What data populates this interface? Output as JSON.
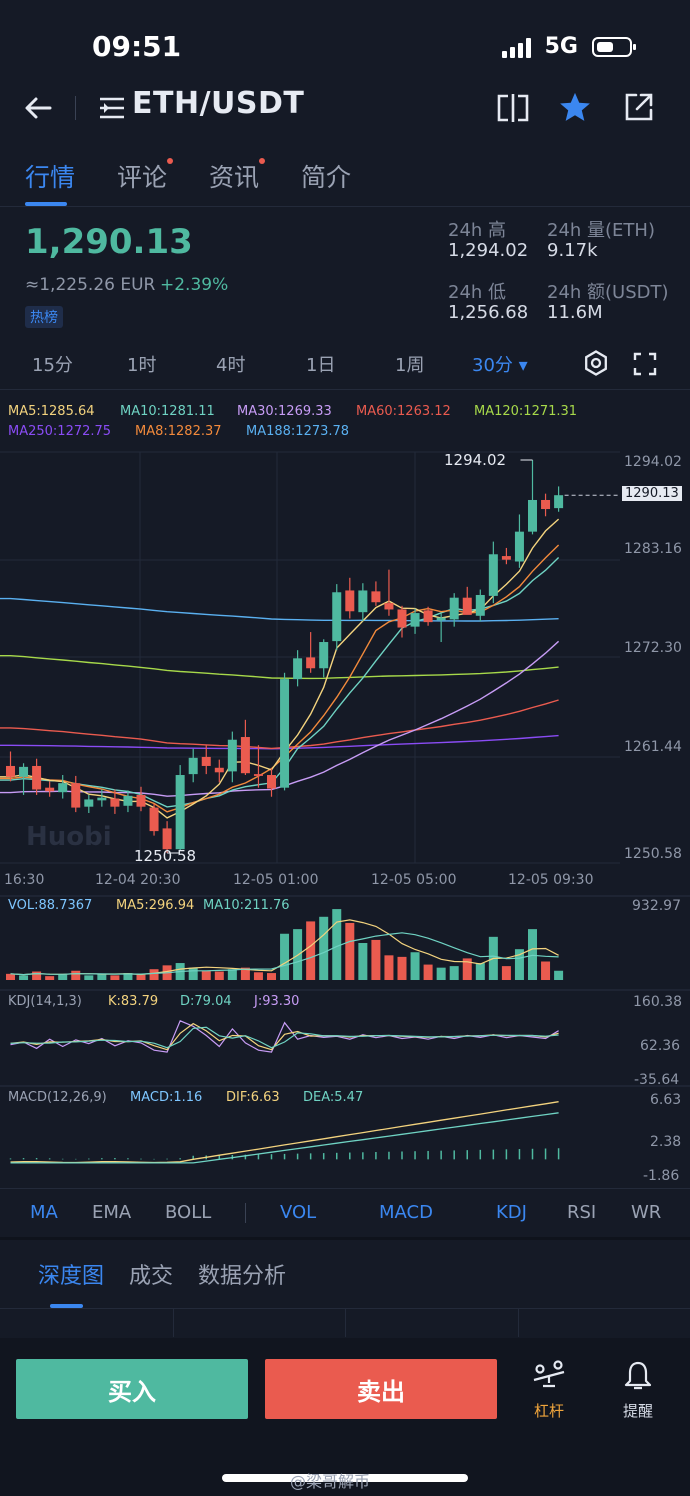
{
  "status_bar": {
    "time": "09:51",
    "network": "5G"
  },
  "header": {
    "pair": "ETH/USDT"
  },
  "tabs": [
    {
      "label": "行情",
      "active": true,
      "dot": false
    },
    {
      "label": "评论",
      "active": false,
      "dot": true
    },
    {
      "label": "资讯",
      "active": false,
      "dot": true
    },
    {
      "label": "简介",
      "active": false,
      "dot": false
    }
  ],
  "ticker": {
    "last_price": "1,290.13",
    "fiat_price": "≈1,225.26 EUR",
    "change": "+2.39%",
    "badge": "热榜",
    "high_label": "24h 高",
    "high": "1,294.02",
    "vol_label": "24h 量(ETH)",
    "vol": "9.17k",
    "low_label": "24h 低",
    "low": "1,256.68",
    "turnover_label": "24h 额(USDT)",
    "turnover": "11.6M"
  },
  "intervals": [
    "15分",
    "1时",
    "4时",
    "1日",
    "1周",
    "30分 ▾"
  ],
  "ma_legend": [
    {
      "text": "MA5:1285.64",
      "color": "#f3d37e"
    },
    {
      "text": "MA10:1281.11",
      "color": "#6fd3c3"
    },
    {
      "text": "MA30:1269.33",
      "color": "#c79cf5"
    },
    {
      "text": "MA60:1263.12",
      "color": "#ea5b4f"
    },
    {
      "text": "MA120:1271.31",
      "color": "#a7d94a"
    },
    {
      "text": "MA250:1272.75",
      "color": "#8a4cf5"
    },
    {
      "text": "MA8:1282.37",
      "color": "#f28a3c"
    },
    {
      "text": "MA188:1273.78",
      "color": "#5ab0f0"
    }
  ],
  "price_axis": [
    "1294.02",
    "1283.16",
    "1272.30",
    "1261.44",
    "1250.58"
  ],
  "current_price_tag": "1290.13",
  "high_marker": "1294.02",
  "low_marker": "1250.58",
  "time_axis": [
    "16:30",
    "12-04 20:30",
    "12-05 01:00",
    "12-05 05:00",
    "12-05 09:30"
  ],
  "volume": {
    "vol": "VOL:88.7367",
    "ma5": "MA5:296.94",
    "ma10": "MA10:211.76",
    "axis_top": "932.97"
  },
  "kdj": {
    "title": "KDJ(14,1,3)",
    "k": "K:83.79",
    "d": "D:79.04",
    "j": "J:93.30",
    "axis": [
      "160.38",
      "62.36",
      "-35.64"
    ]
  },
  "macd": {
    "title": "MACD(12,26,9)",
    "macd": "MACD:1.16",
    "dif": "DIF:6.63",
    "dea": "DEA:5.47",
    "axis": [
      "6.63",
      "2.38",
      "-1.86"
    ]
  },
  "indicator_tabs": [
    {
      "label": "MA",
      "on": true
    },
    {
      "label": "EMA",
      "on": false
    },
    {
      "label": "BOLL",
      "on": false
    },
    {
      "label": "VOL",
      "on": true
    },
    {
      "label": "MACD",
      "on": true
    },
    {
      "label": "KDJ",
      "on": true
    },
    {
      "label": "RSI",
      "on": false
    },
    {
      "label": "WR",
      "on": false
    }
  ],
  "bottom_tabs": [
    "深度图",
    "成交",
    "数据分析"
  ],
  "actions": {
    "buy": "买入",
    "sell": "卖出",
    "leverage": "杠杆",
    "alert": "提醒"
  },
  "watermark": "@梁哥解币",
  "colors": {
    "up": "#4fb9a0",
    "down": "#ea5b4f",
    "accent": "#3b87f0",
    "bg": "#151a26"
  },
  "chart_data": {
    "type": "candlestick",
    "candles": [
      {
        "o": 1260.2,
        "h": 1261.8,
        "l": 1258.5,
        "c": 1259.0
      },
      {
        "o": 1259.0,
        "h": 1260.5,
        "l": 1257.0,
        "c": 1260.1
      },
      {
        "o": 1260.2,
        "h": 1261.0,
        "l": 1257.0,
        "c": 1257.6
      },
      {
        "o": 1257.8,
        "h": 1258.5,
        "l": 1256.8,
        "c": 1257.4
      },
      {
        "o": 1257.3,
        "h": 1259.2,
        "l": 1256.6,
        "c": 1258.3
      },
      {
        "o": 1258.3,
        "h": 1259.1,
        "l": 1255.1,
        "c": 1255.6
      },
      {
        "o": 1255.7,
        "h": 1257.0,
        "l": 1255.0,
        "c": 1256.5
      },
      {
        "o": 1256.4,
        "h": 1257.6,
        "l": 1255.7,
        "c": 1256.7
      },
      {
        "o": 1256.6,
        "h": 1257.6,
        "l": 1254.9,
        "c": 1255.7
      },
      {
        "o": 1255.8,
        "h": 1257.5,
        "l": 1255.1,
        "c": 1256.9
      },
      {
        "o": 1257.0,
        "h": 1257.9,
        "l": 1255.2,
        "c": 1255.7
      },
      {
        "o": 1255.6,
        "h": 1256.0,
        "l": 1252.5,
        "c": 1253.0
      },
      {
        "o": 1253.3,
        "h": 1254.1,
        "l": 1250.58,
        "c": 1251.0
      },
      {
        "o": 1251.0,
        "h": 1260.3,
        "l": 1250.9,
        "c": 1259.2
      },
      {
        "o": 1259.3,
        "h": 1262.1,
        "l": 1258.4,
        "c": 1261.1
      },
      {
        "o": 1261.2,
        "h": 1262.5,
        "l": 1259.3,
        "c": 1260.2
      },
      {
        "o": 1260.0,
        "h": 1260.9,
        "l": 1258.4,
        "c": 1259.5
      },
      {
        "o": 1259.6,
        "h": 1264.0,
        "l": 1258.4,
        "c": 1263.1
      },
      {
        "o": 1263.4,
        "h": 1265.3,
        "l": 1259.2,
        "c": 1259.4
      },
      {
        "o": 1259.3,
        "h": 1262.5,
        "l": 1257.8,
        "c": 1259.1
      },
      {
        "o": 1259.2,
        "h": 1259.9,
        "l": 1256.8,
        "c": 1257.7
      },
      {
        "o": 1257.8,
        "h": 1270.5,
        "l": 1257.5,
        "c": 1269.8
      },
      {
        "o": 1269.8,
        "h": 1273.0,
        "l": 1269.0,
        "c": 1272.1
      },
      {
        "o": 1272.2,
        "h": 1275.0,
        "l": 1270.5,
        "c": 1271.0
      },
      {
        "o": 1271.0,
        "h": 1274.2,
        "l": 1270.0,
        "c": 1273.9
      },
      {
        "o": 1274.0,
        "h": 1280.3,
        "l": 1273.0,
        "c": 1279.4
      },
      {
        "o": 1279.6,
        "h": 1281.0,
        "l": 1276.5,
        "c": 1277.3
      },
      {
        "o": 1277.2,
        "h": 1280.4,
        "l": 1276.2,
        "c": 1279.6
      },
      {
        "o": 1279.5,
        "h": 1280.6,
        "l": 1277.9,
        "c": 1278.3
      },
      {
        "o": 1278.2,
        "h": 1281.9,
        "l": 1276.8,
        "c": 1277.5
      },
      {
        "o": 1277.5,
        "h": 1277.9,
        "l": 1274.4,
        "c": 1275.5
      },
      {
        "o": 1275.6,
        "h": 1277.6,
        "l": 1274.8,
        "c": 1277.1
      },
      {
        "o": 1277.4,
        "h": 1277.8,
        "l": 1275.7,
        "c": 1276.1
      },
      {
        "o": 1276.3,
        "h": 1277.1,
        "l": 1273.9,
        "c": 1276.6
      },
      {
        "o": 1276.4,
        "h": 1279.3,
        "l": 1275.6,
        "c": 1278.8
      },
      {
        "o": 1278.8,
        "h": 1280.0,
        "l": 1277.0,
        "c": 1276.9
      },
      {
        "o": 1276.8,
        "h": 1279.7,
        "l": 1276.2,
        "c": 1279.1
      },
      {
        "o": 1279.0,
        "h": 1285.0,
        "l": 1278.2,
        "c": 1283.6
      },
      {
        "o": 1283.4,
        "h": 1284.3,
        "l": 1282.5,
        "c": 1283.0
      },
      {
        "o": 1282.8,
        "h": 1288.0,
        "l": 1282.1,
        "c": 1286.1
      },
      {
        "o": 1286.1,
        "h": 1294.02,
        "l": 1285.8,
        "c": 1289.6
      },
      {
        "o": 1289.6,
        "h": 1290.3,
        "l": 1287.8,
        "c": 1288.6
      },
      {
        "o": 1288.7,
        "h": 1291.1,
        "l": 1288.3,
        "c": 1290.13
      }
    ],
    "ylim": [
      1250.58,
      1294.02
    ],
    "x_ticks": [
      "16:30",
      "12-04 20:30",
      "12-05 01:00",
      "12-05 05:00",
      "12-05 09:30"
    ]
  }
}
